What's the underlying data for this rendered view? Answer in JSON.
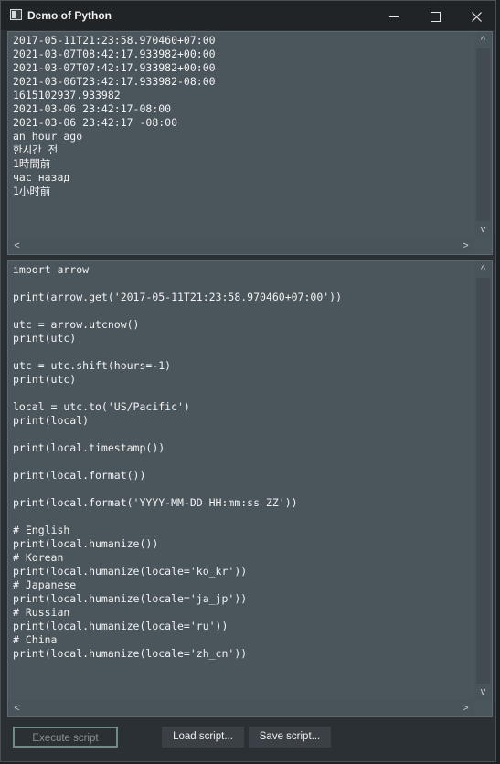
{
  "window": {
    "title": "Demo of Python",
    "controls": {
      "minimize_icon": "minimize-icon",
      "maximize_icon": "maximize-icon",
      "close_icon": "close-icon"
    }
  },
  "output_pane": {
    "text": "2017-05-11T21:23:58.970460+07:00\n2021-03-07T08:42:17.933982+00:00\n2021-03-07T07:42:17.933982+00:00\n2021-03-06T23:42:17.933982-08:00\n1615102937.933982\n2021-03-06 23:42:17-08:00\n2021-03-06 23:42:17 -08:00\nan hour ago\n한시간 전\n1時間前\nчас назад\n1小时前"
  },
  "code_pane": {
    "text": "import arrow\n\nprint(arrow.get('2017-05-11T21:23:58.970460+07:00'))\n\nutc = arrow.utcnow()\nprint(utc)\n\nutc = utc.shift(hours=-1)\nprint(utc)\n\nlocal = utc.to('US/Pacific')\nprint(local)\n\nprint(local.timestamp())\n\nprint(local.format())\n\nprint(local.format('YYYY-MM-DD HH:mm:ss ZZ'))\n\n# English\nprint(local.humanize())\n# Korean\nprint(local.humanize(locale='ko_kr'))\n# Japanese\nprint(local.humanize(locale='ja_jp'))\n# Russian\nprint(local.humanize(locale='ru'))\n# China\nprint(local.humanize(locale='zh_cn'))"
  },
  "buttons": {
    "execute": "Execute script",
    "load": "Load script...",
    "save": "Save script..."
  },
  "scroll_glyphs": {
    "up": "^",
    "down": "v",
    "left": "<",
    "right": ">"
  },
  "colors": {
    "pane_background": "#4a555c",
    "window_background": "#2b3034",
    "titlebar_background": "#202427",
    "execute_border": "#6f8c8a"
  }
}
